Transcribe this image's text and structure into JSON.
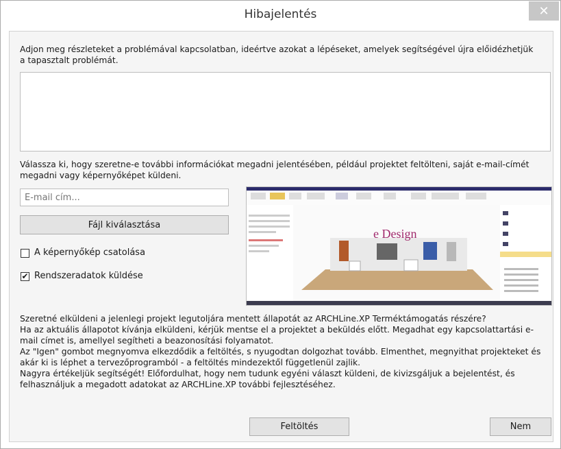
{
  "window": {
    "title": "Hibajelentés",
    "close_glyph": "✕"
  },
  "form": {
    "intro": "Adjon meg részleteket a problémával kapcsolatban, ideértve azokat a lépéseket, amelyek segítségével újra előidézhetjük a tapasztalt problémát.",
    "description_value": "",
    "select_info": "Válassza ki, hogy szeretne-e további információkat megadni jelentésében, például projektet feltölteni, saját e-mail-címét megadni vagy képernyőképet küldeni.",
    "email_placeholder": "E-mail cím...",
    "file_button": "Fájl kiválasztása",
    "screenshot_checkbox": {
      "label": "A képernyőkép csatolása",
      "checked": false
    },
    "sysdata_checkbox": {
      "label": "Rendszeradatok küldése",
      "checked": true,
      "mark": "✔"
    },
    "preview_text": "e Design"
  },
  "upload_text": {
    "line1": "Szeretné elküldeni a jelenlegi projekt legutoljára mentett állapotát az ARCHLine.XP Terméktámogatás részére?",
    "line2": "Ha az aktuális állapotot kívánja elküldeni, kérjük mentse el a projektet a beküldés előtt. Megadhat egy kapcsolattartási e-mail címet is, amellyel segítheti a beazonosítási folyamatot.",
    "line3": "Az \"Igen\" gombot megnyomva elkezdődik a feltöltés, s nyugodtan dolgozhat tovább. Elmenthet, megnyithat projekteket és akár ki is léphet a tervezőprogramból - a feltöltés mindezektől függetlenül zajlik.",
    "line4": "Nagyra értékeljük segítségét! Előfordulhat, hogy nem tudunk egyéni választ küldeni, de kivizsgáljuk a bejelentést, és felhasználjuk a megadott adatokat az ARCHLine.XP további fejlesztéséhez."
  },
  "buttons": {
    "upload": "Feltöltés",
    "no": "Nem"
  },
  "icons": [
    "close-icon",
    "checkmark-icon"
  ],
  "colors": {
    "close_bg": "#c7c7c7",
    "body_bg": "#f5f5f5",
    "button_bg": "#e3e3e3",
    "preview_accent": "#a0296c"
  }
}
